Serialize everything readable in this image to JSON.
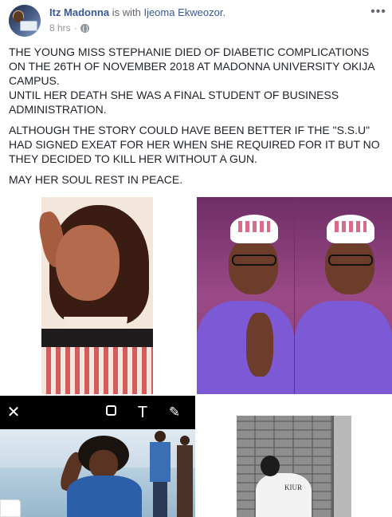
{
  "post": {
    "author": "Itz Madonna",
    "with_text": " is with ",
    "tagged_user": "Ijeoma Ekweozor.",
    "time": "8 hrs",
    "separator": "·",
    "privacy_icon": "globe-icon",
    "more_icon": "more-options-icon",
    "more_glyph": "•••",
    "paragraphs": [
      "THE YOUNG MISS STEPHANIE DIED OF DIABETIC COMPLICATIONS ON THE 26TH OF NOVEMBER 2018 AT MADONNA UNIVERSITY OKIJA CAMPUS.",
      "UNTIL HER DEATH SHE WAS A FINAL STUDENT OF BUSINESS ADMINISTRATION.",
      "ALTHOUGH THE STORY COULD HAVE BEEN BETTER IF THE \"S.S.U\" HAD SIGNED EXEAT FOR HER WHEN SHE REQUIRED FOR IT BUT NO THEY DECIDED TO KILL HER WITHOUT A GUN.",
      "MAY HER SOUL REST IN PEACE."
    ]
  },
  "snapshot_toolbar": {
    "close_glyph": "✕",
    "text_glyph": "T",
    "pen_glyph": "✎"
  },
  "photo4": {
    "shirt_text": "KIUR"
  },
  "colors": {
    "link": "#385898",
    "meta": "#90949c",
    "text": "#1d2129"
  }
}
